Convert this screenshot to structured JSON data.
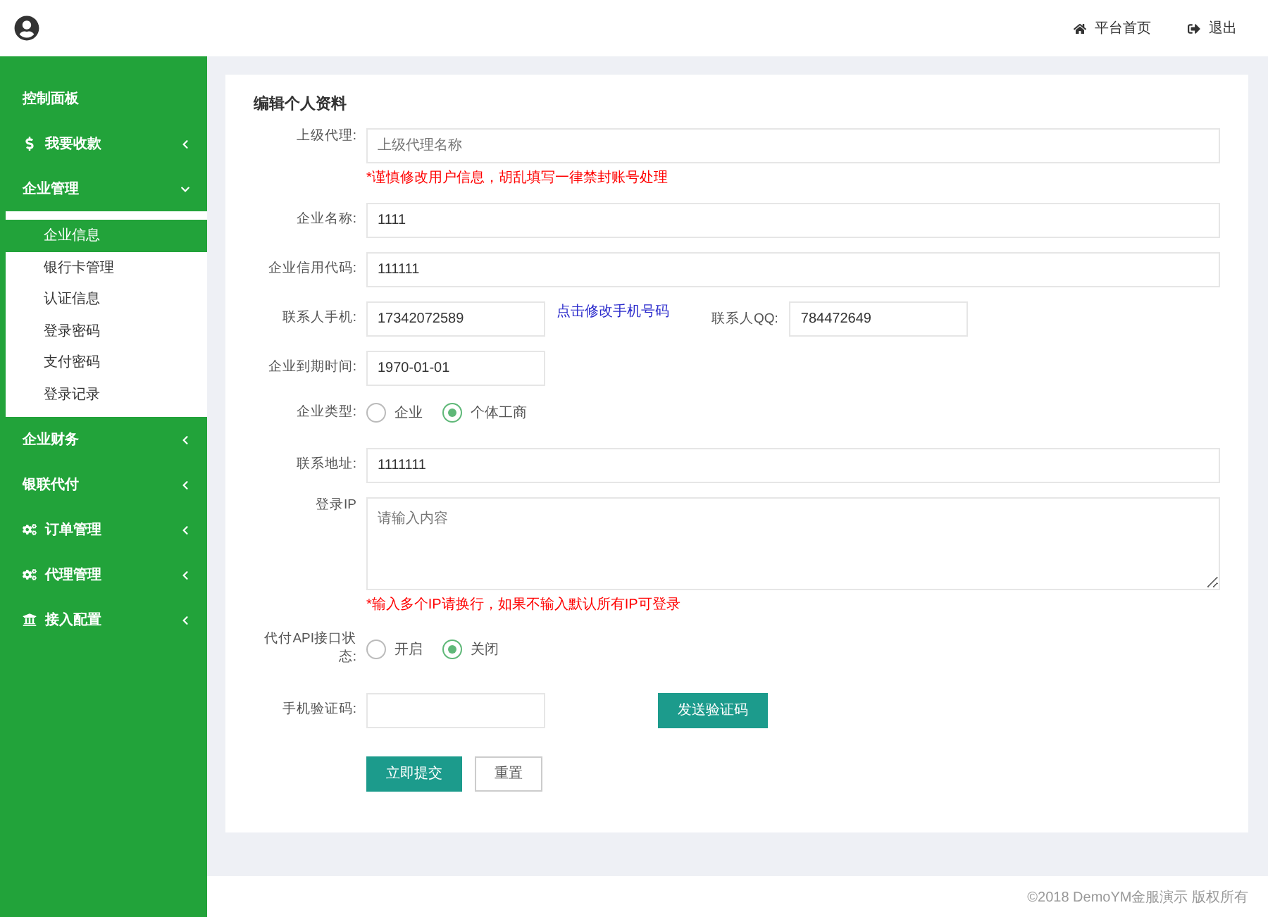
{
  "header": {
    "links": [
      {
        "kind": "home",
        "label": "平台首页"
      },
      {
        "kind": "exit",
        "label": "退出"
      }
    ]
  },
  "sidebar": {
    "items": [
      {
        "kind": "text",
        "label": "控制面板"
      },
      {
        "kind": "dollar",
        "label": "我要收款",
        "expanded": false
      },
      {
        "kind": "text",
        "label": "企业管理",
        "expanded": true,
        "children": [
          {
            "label": "企业信息",
            "selected": true
          },
          {
            "label": "银行卡管理",
            "selected": false
          },
          {
            "label": "认证信息",
            "selected": false
          },
          {
            "label": "登录密码",
            "selected": false
          },
          {
            "label": "支付密码",
            "selected": false
          },
          {
            "label": "登录记录",
            "selected": false
          }
        ]
      },
      {
        "kind": "text",
        "label": "企业财务",
        "expanded": false
      },
      {
        "kind": "text",
        "label": "银联代付",
        "expanded": false
      },
      {
        "kind": "cogs",
        "label": "订单管理",
        "expanded": false
      },
      {
        "kind": "cogs",
        "label": "代理管理",
        "expanded": false
      },
      {
        "kind": "bank",
        "label": "接入配置",
        "expanded": false
      }
    ]
  },
  "form": {
    "title": "编辑个人资料",
    "rows": [
      {
        "kind": "input",
        "label": "上级代理:",
        "placeholder": "上级代理名称",
        "hint": "*谨慎修改用户信息，胡乱填写一律禁封账号处理"
      },
      {
        "kind": "input",
        "label": "企业名称:",
        "value": "1111"
      },
      {
        "kind": "input",
        "label": "企业信用代码:",
        "value": "111111"
      },
      {
        "kind": "contact",
        "label": "联系人手机:",
        "value": "17342072589",
        "link": "点击修改手机号码",
        "qq_label": "联系人QQ:",
        "qq_value": "784472649"
      },
      {
        "kind": "short-input",
        "label": "企业到期时间:",
        "value": "1970-01-01"
      },
      {
        "kind": "radio",
        "label": "企业类型:",
        "options": [
          {
            "label": "企业",
            "selected": false
          },
          {
            "label": "个体工商",
            "selected": true
          }
        ]
      },
      {
        "kind": "input",
        "label": "联系地址:",
        "value": "1111111"
      },
      {
        "kind": "textarea",
        "label": "登录IP",
        "placeholder": "请输入内容",
        "hint": "*输入多个IP请换行，如果不输入默认所有IP可登录"
      },
      {
        "kind": "radio",
        "label": "代付API接口状态:",
        "options": [
          {
            "label": "开启",
            "selected": false
          },
          {
            "label": "关闭",
            "selected": true
          }
        ]
      },
      {
        "kind": "code",
        "label": "手机验证码:",
        "button": "发送验证码"
      }
    ],
    "buttons": [
      {
        "kind": "primary",
        "label": "立即提交"
      },
      {
        "kind": "secondary",
        "label": "重置"
      }
    ]
  },
  "footer": {
    "text": "©2018 DemoYM金服演示 版权所有"
  }
}
